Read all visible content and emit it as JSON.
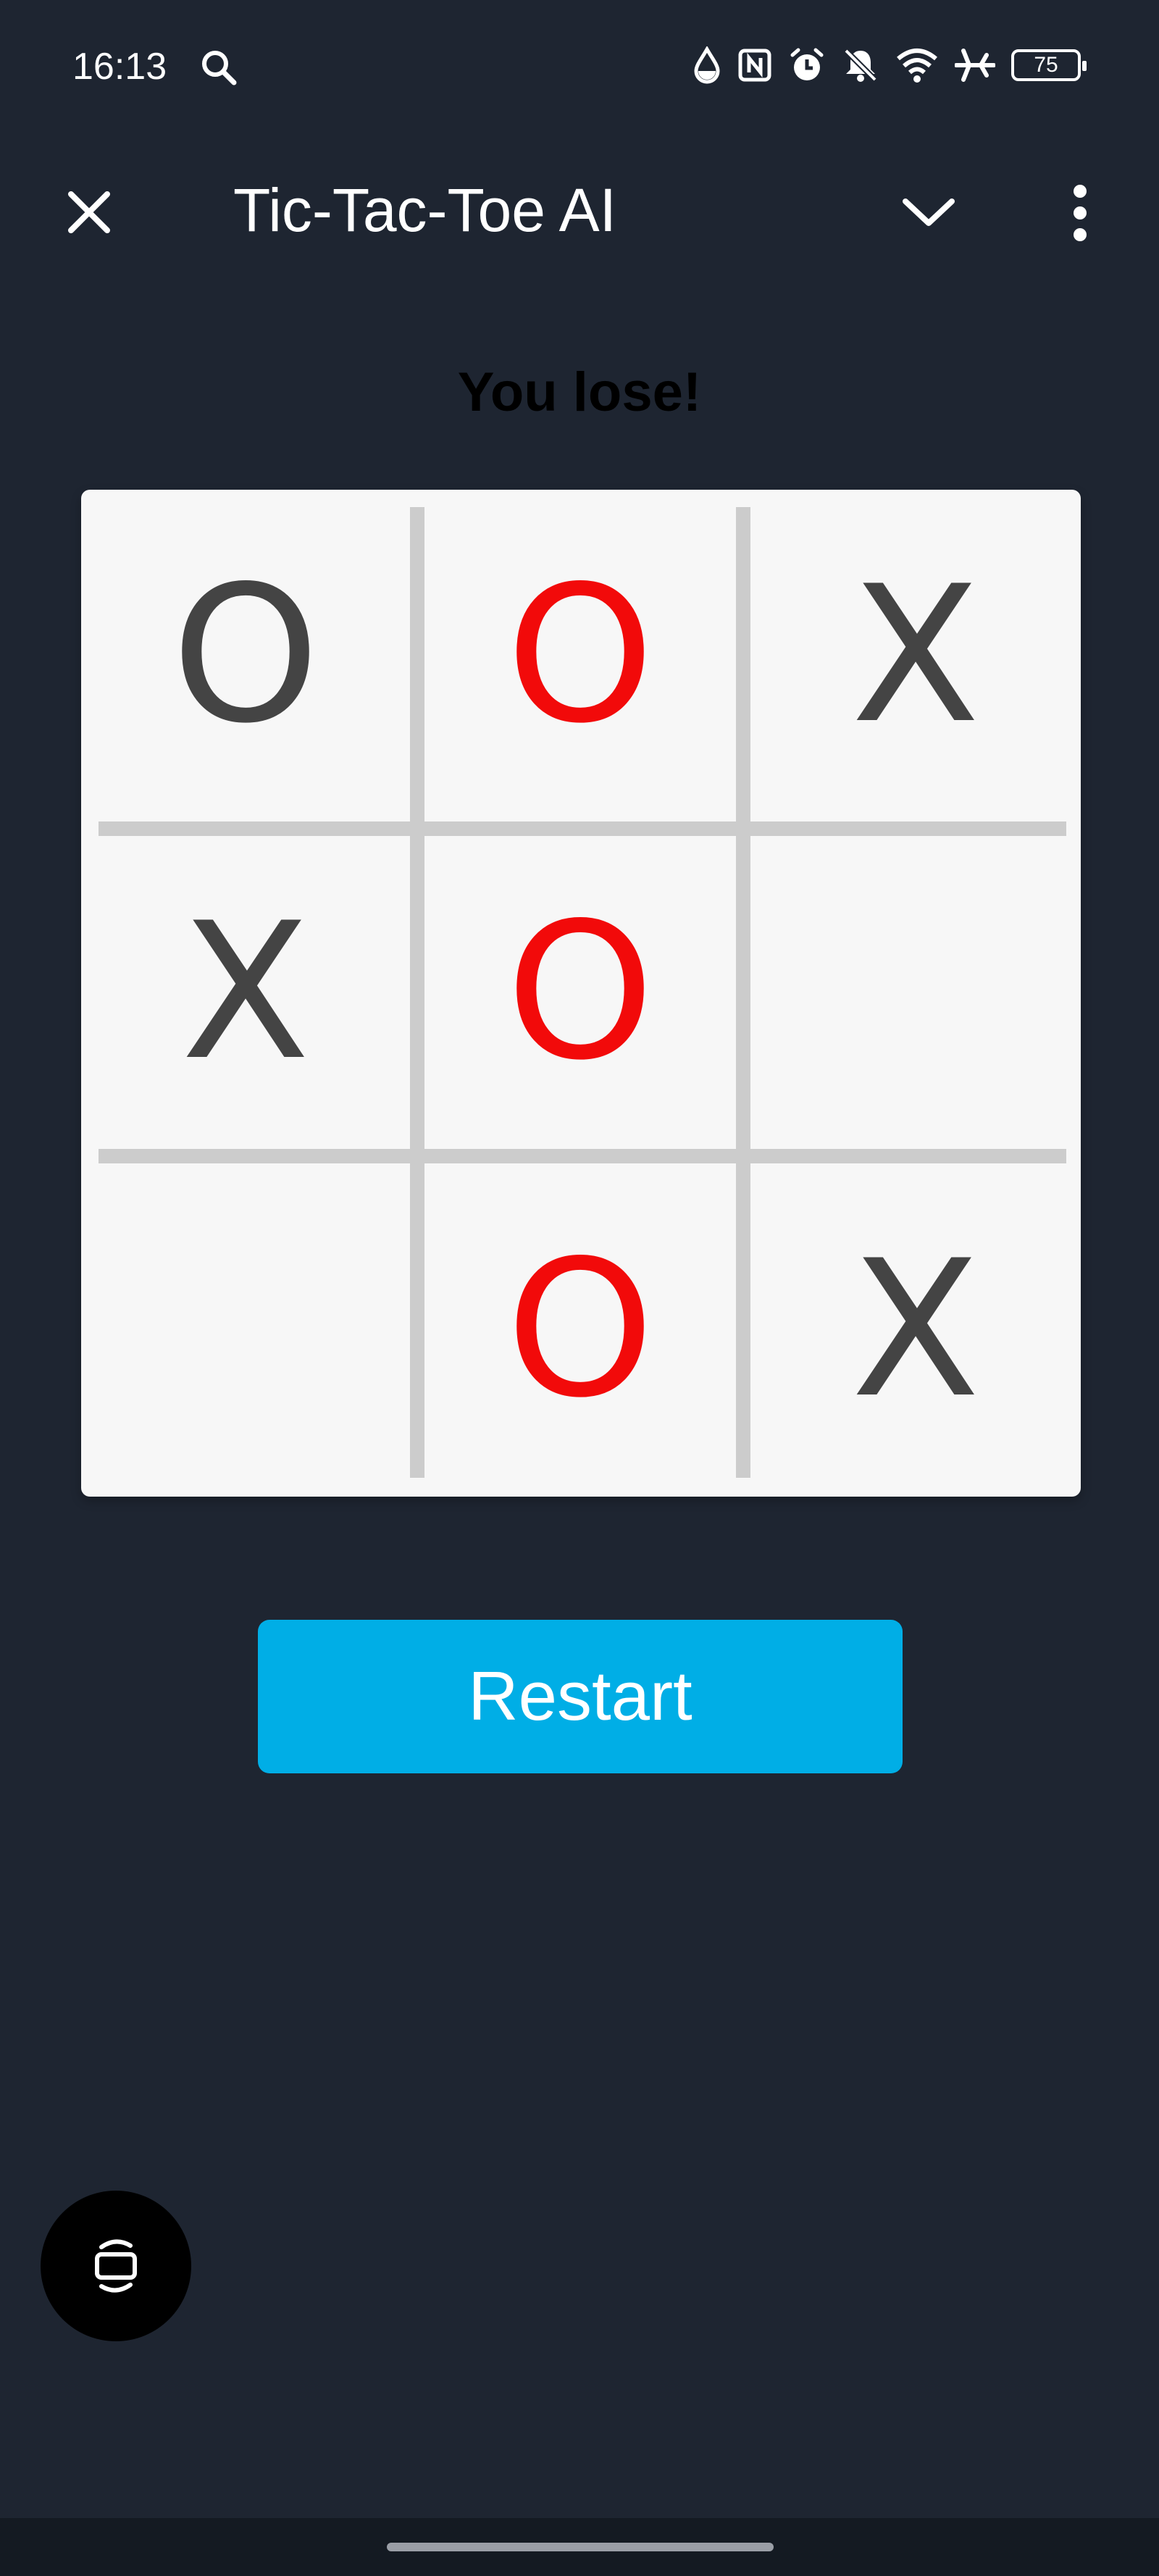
{
  "status_bar": {
    "time": "16:13",
    "battery": "75",
    "icons": [
      "search-icon",
      "water-drop-icon",
      "nfc-icon",
      "alarm-icon",
      "bell-off-icon",
      "wifi-icon",
      "airplane-icon",
      "battery-icon"
    ]
  },
  "app_bar": {
    "title": "Tic-Tac-Toe AI",
    "close_icon": "close-icon",
    "collapse_icon": "chevron-down-icon",
    "menu_icon": "more-vert-icon"
  },
  "game": {
    "status": "You lose!",
    "board": [
      [
        "O",
        "O",
        "X"
      ],
      [
        "X",
        "O",
        ""
      ],
      [
        "",
        "O",
        "X"
      ]
    ],
    "winning_cells": [
      "0-1",
      "1-1",
      "2-1"
    ],
    "colors": {
      "mark": "#444444",
      "winning_mark": "#f20a0a",
      "board_bg": "#f7f7f7",
      "grid_line": "#cccccc"
    }
  },
  "restart": {
    "label": "Restart",
    "color": "#00aee6"
  },
  "floating_button": {
    "icon": "screen-rotate-icon"
  },
  "theme": {
    "background": "#1e2531"
  }
}
